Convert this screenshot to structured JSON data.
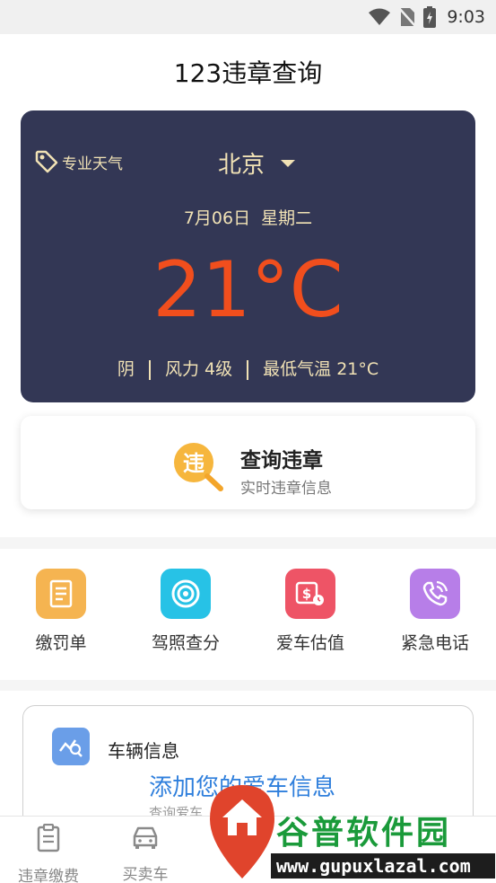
{
  "status_bar": {
    "time": "9:03",
    "icons": [
      "wifi-icon",
      "no-sim-icon",
      "battery-charging-icon"
    ]
  },
  "header": {
    "title": "123违章查询"
  },
  "weather": {
    "tag_label": "专业天气",
    "city": "北京",
    "date": "7月06日",
    "weekday": "星期二",
    "temperature": "21°C",
    "condition": "阴",
    "wind": "风力 4级",
    "low_temp": "最低气温 21°C",
    "colors": {
      "bg": "#333755",
      "text": "#f1e2b5",
      "temp": "#f14e1d"
    }
  },
  "query": {
    "icon_char": "违",
    "title": "查询违章",
    "subtitle": "实时违章信息"
  },
  "tools": [
    {
      "label": "缴罚单",
      "icon": "receipt-icon",
      "color": "#f5b451"
    },
    {
      "label": "驾照查分",
      "icon": "target-icon",
      "color": "#27c2e6"
    },
    {
      "label": "爱车估值",
      "icon": "price-tag-icon",
      "color": "#ee5466"
    },
    {
      "label": "紧急电话",
      "icon": "phone-icon",
      "color": "#b77ee8"
    }
  ],
  "vehicle": {
    "title": "车辆信息",
    "add_label": "添加您的爱车信息",
    "hint": "查询爱车"
  },
  "nav": [
    {
      "label": "违章缴费",
      "icon": "clipboard-icon"
    },
    {
      "label": "买卖车",
      "icon": "car-icon"
    }
  ],
  "watermark": {
    "brand": "谷普软件园",
    "url": "www.gupuxlazal.com"
  }
}
